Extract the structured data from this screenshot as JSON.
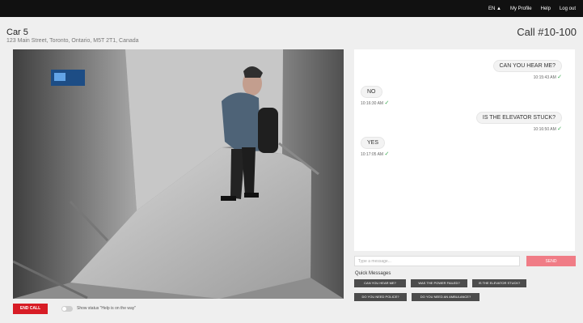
{
  "topbar": {
    "language": "EN ▲",
    "profile": "My Profile",
    "help": "Help",
    "logout": "Log out"
  },
  "header": {
    "car": "Car 5",
    "address": "123 Main Street, Toronto, Ontario, M5T 2T1, Canada",
    "call": "Call #10-100"
  },
  "chat": {
    "messages": [
      {
        "side": "right",
        "text": "CAN YOU HEAR ME?",
        "time": "10:15:43 AM"
      },
      {
        "side": "left",
        "text": "NO",
        "time": "10:16:30 AM"
      },
      {
        "side": "right",
        "text": "IS THE ELEVATOR STUCK?",
        "time": "10:16:50 AM"
      },
      {
        "side": "left",
        "text": "YES",
        "time": "10:17:05 AM"
      }
    ],
    "input_placeholder": "Type a message...",
    "send": "SEND"
  },
  "quick_messages": {
    "label": "Quick Messages",
    "items": [
      "CAN YOU HEAR ME?",
      "WAS THE POWER FAILED?",
      "IS THE ELEVATOR STUCK?",
      "DO YOU NEED POLICE?",
      "DO YOU NEED AN AMBULANCE?"
    ]
  },
  "footer": {
    "end_call": "END CALL",
    "status_label": "Show status \"Help is on the way\""
  },
  "icons": {
    "check": "check-icon"
  },
  "colors": {
    "end_call": "#d71c25",
    "send": "#f07c86",
    "check": "#36a94d",
    "quick_button": "#4c4c4c"
  }
}
